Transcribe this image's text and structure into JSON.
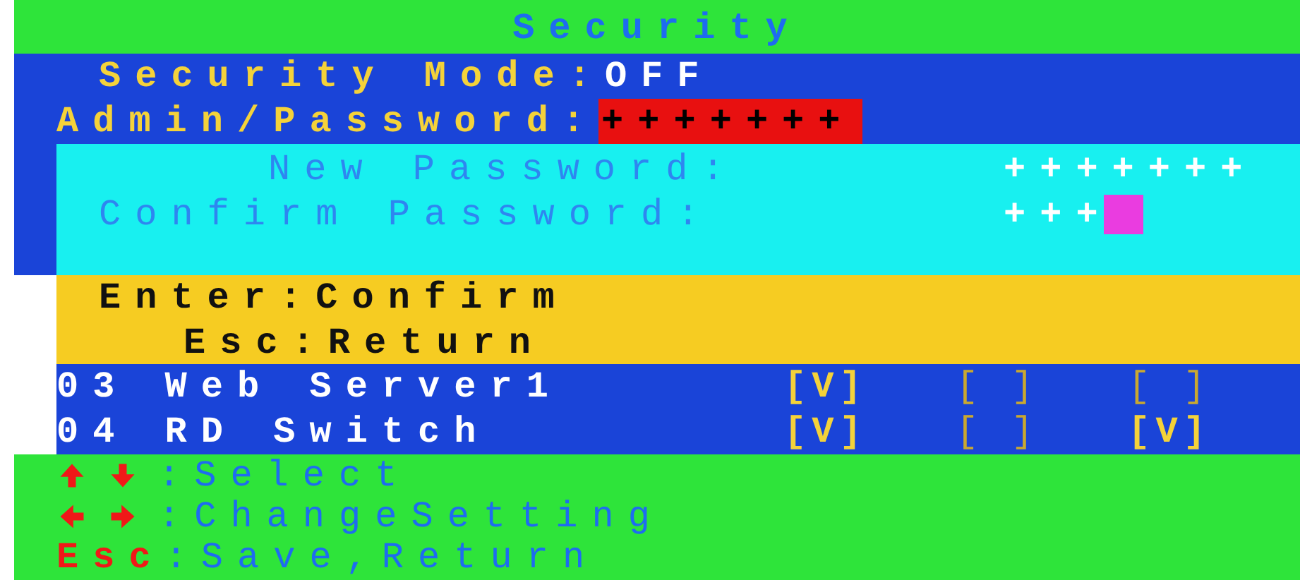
{
  "title": "Security",
  "security_mode": {
    "label": "Security Mode:",
    "value": "OFF"
  },
  "admin_password": {
    "label": "Admin/Password:",
    "value": "+++++++"
  },
  "password_dialog": {
    "fields": [
      {
        "label": "New Password:",
        "value": "+++++++"
      },
      {
        "label": "Confirm Password:",
        "value": "+++"
      }
    ],
    "hints": [
      {
        "key": "Enter",
        "action": ":Confirm"
      },
      {
        "key": "Esc",
        "action": ":Return"
      }
    ]
  },
  "servers": [
    {
      "name": "03 Web Server1",
      "cells": [
        {
          "text": "[V]",
          "checked": true
        },
        {
          "text": "[ ]",
          "checked": false
        },
        {
          "text": "[ ]",
          "checked": false
        }
      ]
    },
    {
      "name": "04 RD Switch",
      "cells": [
        {
          "text": "[V]",
          "checked": true
        },
        {
          "text": "[ ]",
          "checked": false
        },
        {
          "text": "[V]",
          "checked": true
        }
      ]
    }
  ],
  "help": [
    {
      "kind": "vertical",
      "action": ":Select"
    },
    {
      "kind": "horizontal",
      "action": ":ChangeSetting"
    },
    {
      "kind": "key",
      "key": "Esc",
      "action": ":Save,Return"
    }
  ]
}
